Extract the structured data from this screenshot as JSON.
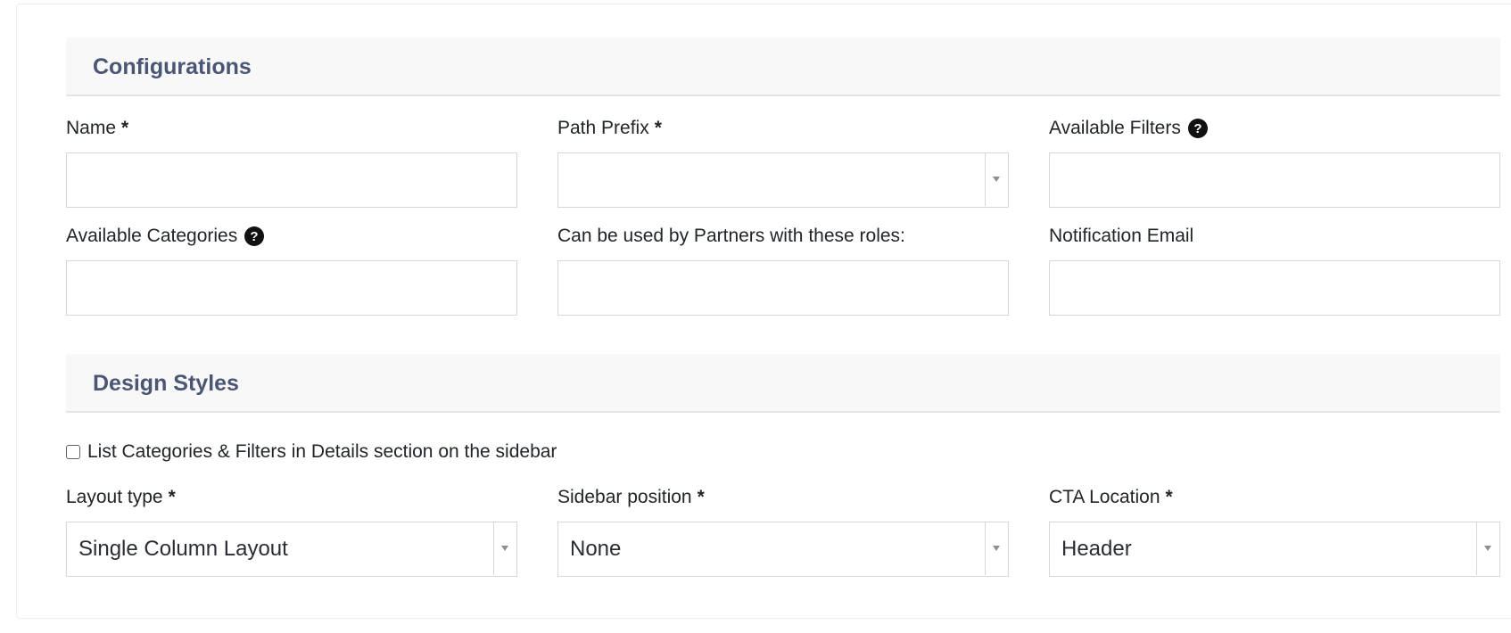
{
  "sections": {
    "configurations": {
      "title": "Configurations"
    },
    "design_styles": {
      "title": "Design Styles"
    }
  },
  "fields": {
    "name": {
      "label": "Name",
      "required_mark": "*",
      "value": ""
    },
    "path_prefix": {
      "label": "Path Prefix",
      "required_mark": "*",
      "value": ""
    },
    "available_filters": {
      "label": "Available Filters",
      "help_icon": "question-circle-icon",
      "value": ""
    },
    "available_categories": {
      "label": "Available Categories",
      "help_icon": "question-circle-icon",
      "value": ""
    },
    "partner_roles": {
      "label": "Can be used by Partners with these roles:",
      "value": ""
    },
    "notification_email": {
      "label": "Notification Email",
      "value": ""
    },
    "list_categories_checkbox": {
      "label": "List Categories & Filters in Details section on the sidebar",
      "checked": false
    },
    "layout_type": {
      "label": "Layout type",
      "required_mark": "*",
      "value": "Single Column Layout"
    },
    "sidebar_position": {
      "label": "Sidebar position",
      "required_mark": "*",
      "value": "None"
    },
    "cta_location": {
      "label": "CTA Location",
      "required_mark": "*",
      "value": "Header"
    }
  },
  "colors": {
    "section_title": "#4b5675",
    "section_bg": "#f8f8f9",
    "border": "#d4d7db"
  }
}
